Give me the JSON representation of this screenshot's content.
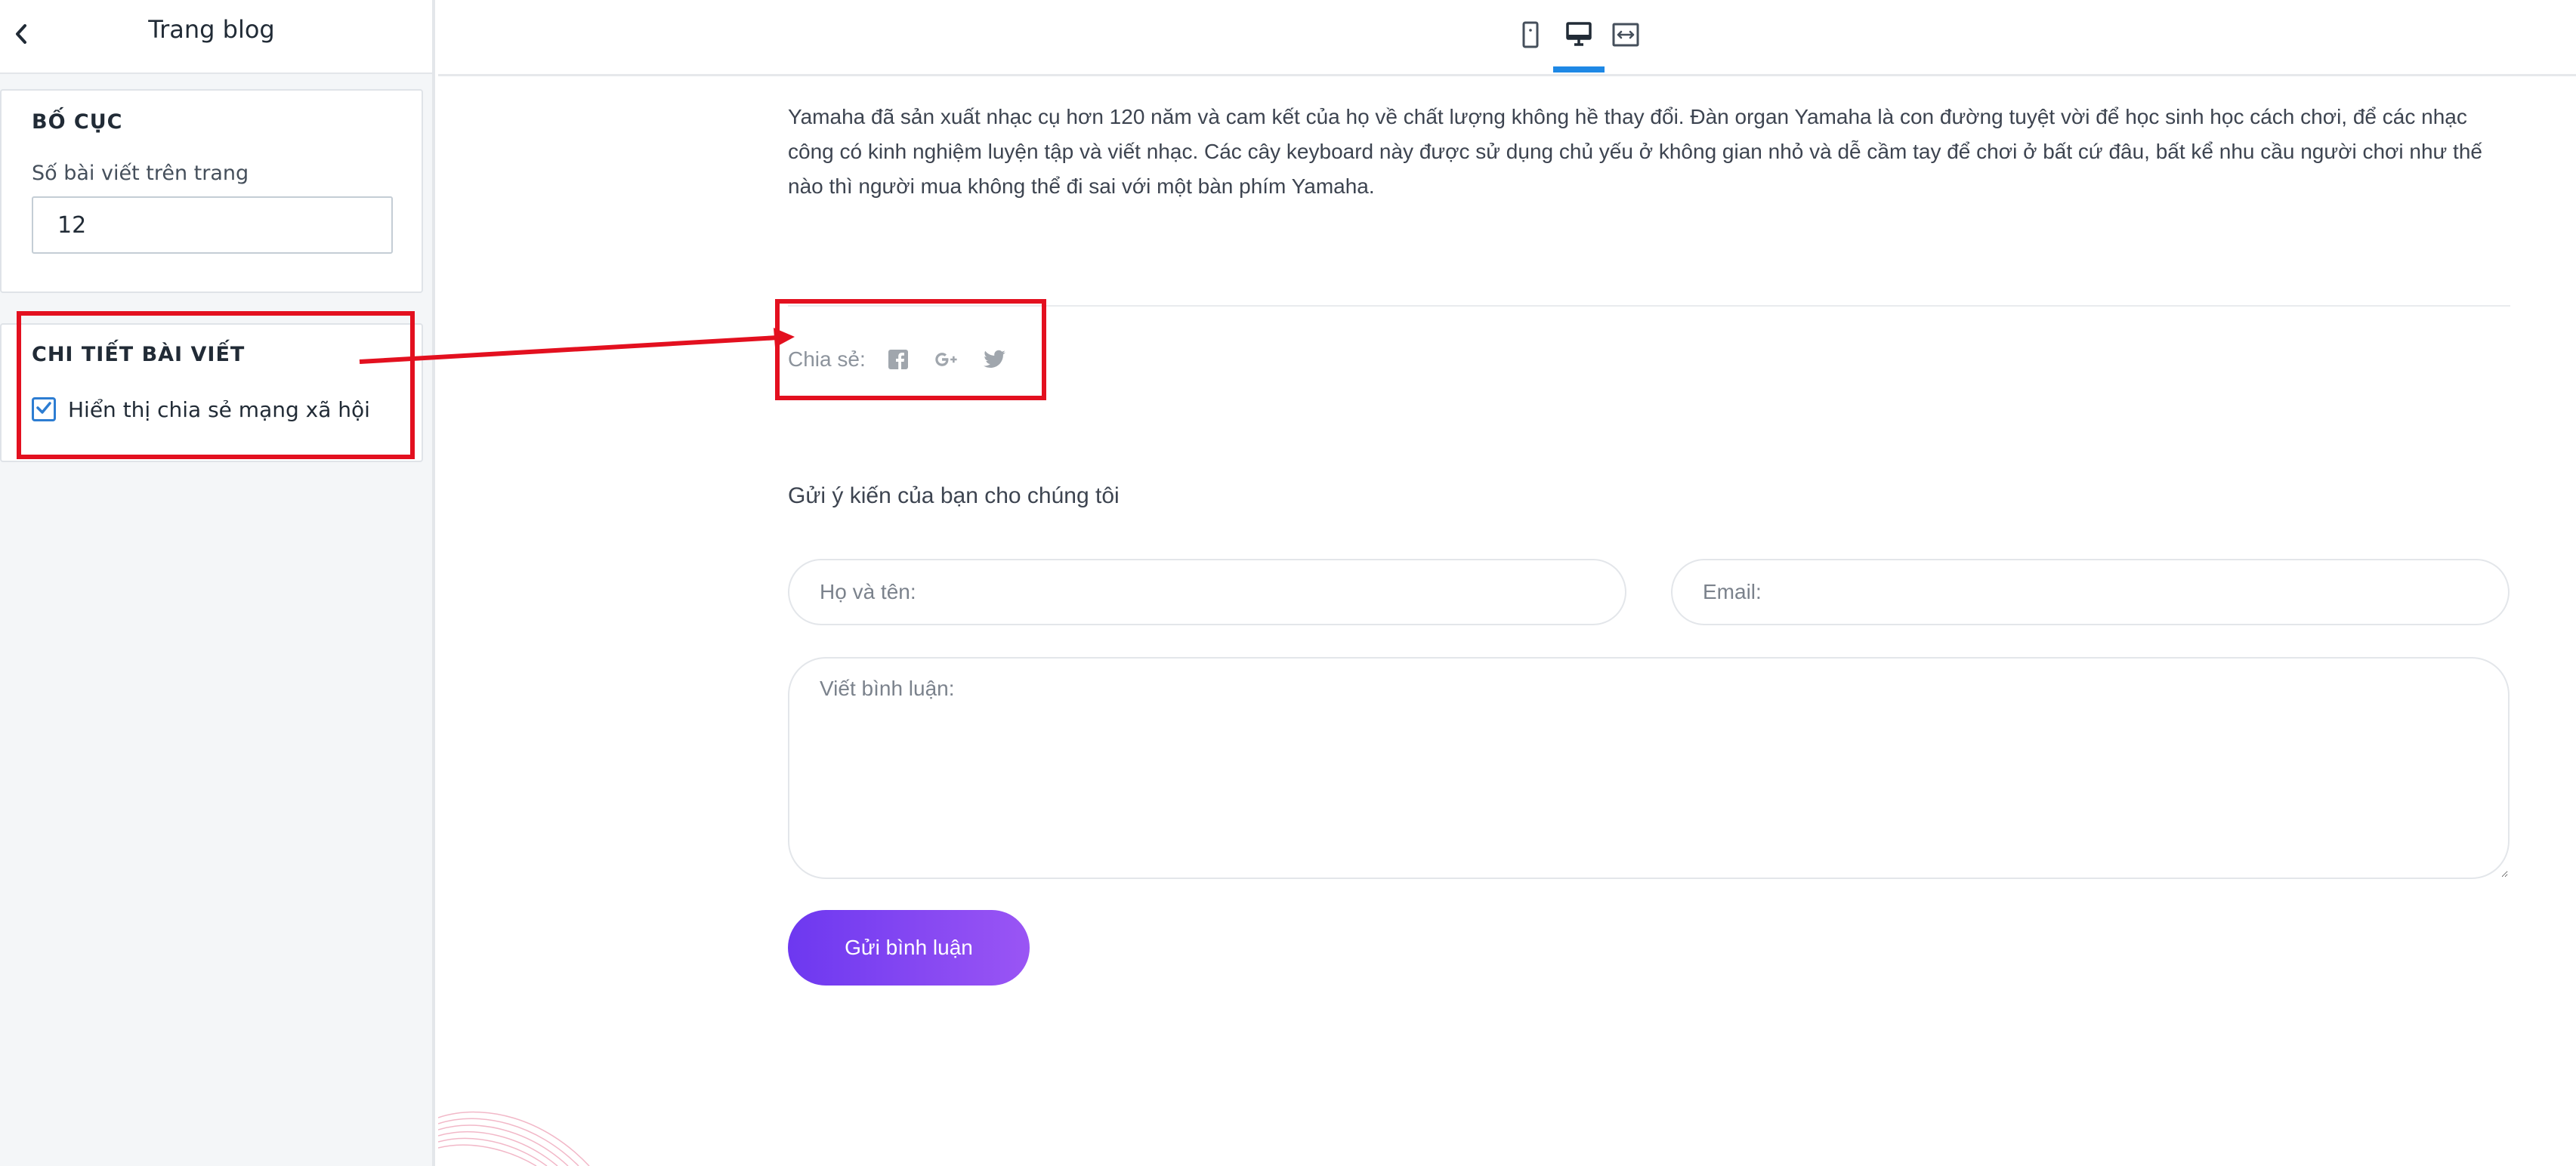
{
  "sidebar": {
    "title": "Trang blog",
    "layout_section": {
      "heading": "BỐ CỤC",
      "posts_per_page_label": "Số bài viết trên trang",
      "posts_per_page_value": "12"
    },
    "post_detail_section": {
      "heading": "CHI TIẾT BÀI VIẾT",
      "show_social_share_label": "Hiển thị chia sẻ mạng xã hội",
      "show_social_share_checked": true
    }
  },
  "topbar": {
    "devices": [
      {
        "icon": "mobile-icon",
        "active": false
      },
      {
        "icon": "desktop-icon",
        "active": true
      },
      {
        "icon": "fullwidth-icon",
        "active": false
      }
    ],
    "active_color": "#1e88e5"
  },
  "article": {
    "text": "Yamaha đã sản xuất nhạc cụ hơn 120 năm và cam kết của họ về chất lượng không hề thay đổi. Đàn organ Yamaha là  con đường tuyệt vời để học sinh học cách chơi, để các nhạc công có kinh nghiệm luyện tập và viết nhạc. Các cây keyboard này được sử dụng chủ yếu ở không gian nhỏ và dễ cầm tay để chơi ở bất cứ đâu, bất kể nhu cầu người chơi như thế nào thì người mua không thể đi sai với một bàn phím Yamaha."
  },
  "share": {
    "label": "Chia sẻ:",
    "icons": [
      "facebook-icon",
      "google-plus-icon",
      "twitter-icon"
    ]
  },
  "comment_form": {
    "title": "Gửi ý kiến của bạn cho chúng tôi",
    "name_placeholder": "Họ và tên:",
    "email_placeholder": "Email:",
    "comment_placeholder": "Viết bình luận:",
    "submit_label": "Gửi bình luận",
    "button_gradient": [
      "#6d38f0",
      "#9a55f4"
    ]
  },
  "annotation_color": "#e3101f"
}
